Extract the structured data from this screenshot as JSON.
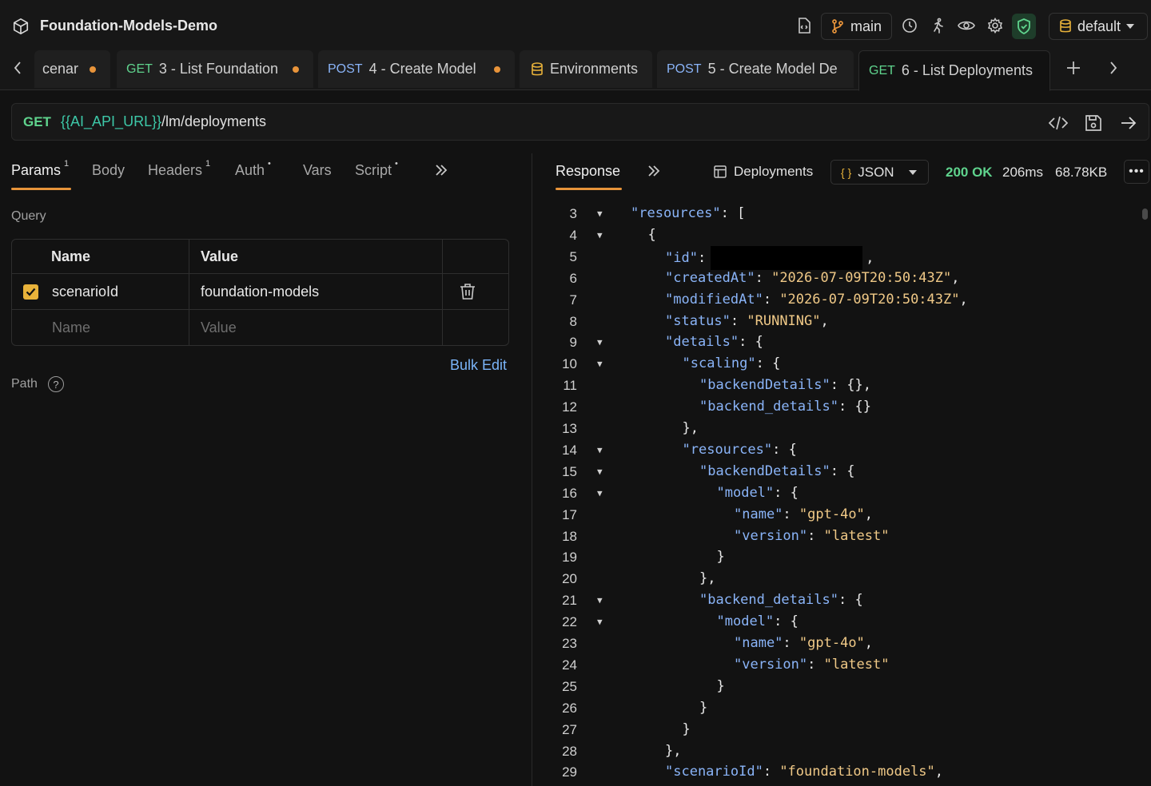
{
  "app": {
    "title": "Foundation-Models-Demo",
    "branch": "main",
    "environment": "default"
  },
  "tabs": [
    {
      "method": "",
      "label": "cenar",
      "dirty": true
    },
    {
      "method": "GET",
      "label": "3 - List Foundation",
      "dirty": true
    },
    {
      "method": "POST",
      "label": "4 - Create Model",
      "dirty": true
    },
    {
      "method": "",
      "label": "Environments",
      "dirty": false
    },
    {
      "method": "POST",
      "label": "5 - Create Model De",
      "dirty": false
    },
    {
      "method": "GET",
      "label": "6 - List Deployments",
      "dirty": false,
      "active": true
    }
  ],
  "request": {
    "method": "GET",
    "url_variable": "{{AI_API_URL}}",
    "url_path": "/lm/deployments"
  },
  "request_tabs": [
    {
      "label": "Params",
      "badge": "1",
      "active": true
    },
    {
      "label": "Body",
      "badge": ""
    },
    {
      "label": "Headers",
      "badge": "1"
    },
    {
      "label": "Auth",
      "badge": "•"
    },
    {
      "label": "Vars",
      "badge": ""
    },
    {
      "label": "Script",
      "badge": "•"
    }
  ],
  "query": {
    "section_label": "Query",
    "col_name": "Name",
    "col_value": "Value",
    "rows": [
      {
        "enabled": true,
        "name": "scenarioId",
        "value": "foundation-models"
      }
    ],
    "new_row": {
      "name_placeholder": "Name",
      "value_placeholder": "Value"
    },
    "bulk_edit_label": "Bulk Edit",
    "path_label": "Path",
    "help_glyph": "?"
  },
  "response": {
    "tab_label": "Response",
    "view_label": "Deployments",
    "format": "JSON",
    "format_glyph": "{ }",
    "status": "200 OK",
    "time": "206ms",
    "size": "68.78KB",
    "lines": [
      {
        "n": "3",
        "fold": true,
        "indent": 0,
        "tokens": [
          [
            "k",
            "\"resources\""
          ],
          [
            "p",
            ": ["
          ]
        ]
      },
      {
        "n": "4",
        "fold": true,
        "indent": 1,
        "tokens": [
          [
            "p",
            "{"
          ]
        ]
      },
      {
        "n": "5",
        "fold": false,
        "indent": 2,
        "tokens": [
          [
            "k",
            "\"id\""
          ],
          [
            "p",
            ":"
          ],
          [
            "redact",
            ""
          ],
          [
            "p",
            ","
          ]
        ]
      },
      {
        "n": "6",
        "fold": false,
        "indent": 2,
        "tokens": [
          [
            "k",
            "\"createdAt\""
          ],
          [
            "p",
            ": "
          ],
          [
            "s",
            "\"2026-07-09T20:50:43Z\""
          ],
          [
            "p",
            ","
          ]
        ]
      },
      {
        "n": "7",
        "fold": false,
        "indent": 2,
        "tokens": [
          [
            "k",
            "\"modifiedAt\""
          ],
          [
            "p",
            ": "
          ],
          [
            "s",
            "\"2026-07-09T20:50:43Z\""
          ],
          [
            "p",
            ","
          ]
        ]
      },
      {
        "n": "8",
        "fold": false,
        "indent": 2,
        "tokens": [
          [
            "k",
            "\"status\""
          ],
          [
            "p",
            ": "
          ],
          [
            "s",
            "\"RUNNING\""
          ],
          [
            "p",
            ","
          ]
        ]
      },
      {
        "n": "9",
        "fold": true,
        "indent": 2,
        "tokens": [
          [
            "k",
            "\"details\""
          ],
          [
            "p",
            ": {"
          ]
        ]
      },
      {
        "n": "10",
        "fold": true,
        "indent": 3,
        "tokens": [
          [
            "k",
            "\"scaling\""
          ],
          [
            "p",
            ": {"
          ]
        ]
      },
      {
        "n": "11",
        "fold": false,
        "indent": 4,
        "tokens": [
          [
            "k",
            "\"backendDetails\""
          ],
          [
            "p",
            ": {},"
          ]
        ]
      },
      {
        "n": "12",
        "fold": false,
        "indent": 4,
        "tokens": [
          [
            "k",
            "\"backend_details\""
          ],
          [
            "p",
            ": {}"
          ]
        ]
      },
      {
        "n": "13",
        "fold": false,
        "indent": 3,
        "tokens": [
          [
            "p",
            "},"
          ]
        ]
      },
      {
        "n": "14",
        "fold": true,
        "indent": 3,
        "tokens": [
          [
            "k",
            "\"resources\""
          ],
          [
            "p",
            ": {"
          ]
        ]
      },
      {
        "n": "15",
        "fold": true,
        "indent": 4,
        "tokens": [
          [
            "k",
            "\"backendDetails\""
          ],
          [
            "p",
            ": {"
          ]
        ]
      },
      {
        "n": "16",
        "fold": true,
        "indent": 5,
        "tokens": [
          [
            "k",
            "\"model\""
          ],
          [
            "p",
            ": {"
          ]
        ]
      },
      {
        "n": "17",
        "fold": false,
        "indent": 6,
        "tokens": [
          [
            "k",
            "\"name\""
          ],
          [
            "p",
            ": "
          ],
          [
            "s",
            "\"gpt-4o\""
          ],
          [
            "p",
            ","
          ]
        ]
      },
      {
        "n": "18",
        "fold": false,
        "indent": 6,
        "tokens": [
          [
            "k",
            "\"version\""
          ],
          [
            "p",
            ": "
          ],
          [
            "s",
            "\"latest\""
          ]
        ]
      },
      {
        "n": "19",
        "fold": false,
        "indent": 5,
        "tokens": [
          [
            "p",
            "}"
          ]
        ]
      },
      {
        "n": "20",
        "fold": false,
        "indent": 4,
        "tokens": [
          [
            "p",
            "},"
          ]
        ]
      },
      {
        "n": "21",
        "fold": true,
        "indent": 4,
        "tokens": [
          [
            "k",
            "\"backend_details\""
          ],
          [
            "p",
            ": {"
          ]
        ]
      },
      {
        "n": "22",
        "fold": true,
        "indent": 5,
        "tokens": [
          [
            "k",
            "\"model\""
          ],
          [
            "p",
            ": {"
          ]
        ]
      },
      {
        "n": "23",
        "fold": false,
        "indent": 6,
        "tokens": [
          [
            "k",
            "\"name\""
          ],
          [
            "p",
            ": "
          ],
          [
            "s",
            "\"gpt-4o\""
          ],
          [
            "p",
            ","
          ]
        ]
      },
      {
        "n": "24",
        "fold": false,
        "indent": 6,
        "tokens": [
          [
            "k",
            "\"version\""
          ],
          [
            "p",
            ": "
          ],
          [
            "s",
            "\"latest\""
          ]
        ]
      },
      {
        "n": "25",
        "fold": false,
        "indent": 5,
        "tokens": [
          [
            "p",
            "}"
          ]
        ]
      },
      {
        "n": "26",
        "fold": false,
        "indent": 4,
        "tokens": [
          [
            "p",
            "}"
          ]
        ]
      },
      {
        "n": "27",
        "fold": false,
        "indent": 3,
        "tokens": [
          [
            "p",
            "}"
          ]
        ]
      },
      {
        "n": "28",
        "fold": false,
        "indent": 2,
        "tokens": [
          [
            "p",
            "},"
          ]
        ]
      },
      {
        "n": "29",
        "fold": false,
        "indent": 2,
        "tokens": [
          [
            "k",
            "\"scenarioId\""
          ],
          [
            "p",
            ": "
          ],
          [
            "s",
            "\"foundation-models\""
          ],
          [
            "p",
            ","
          ]
        ]
      }
    ]
  },
  "colors": {
    "accent": "#e8943a",
    "get": "#5fd38d",
    "post": "#8ab4f8",
    "json_key": "#8ab4f8",
    "json_string": "#f0c987"
  }
}
